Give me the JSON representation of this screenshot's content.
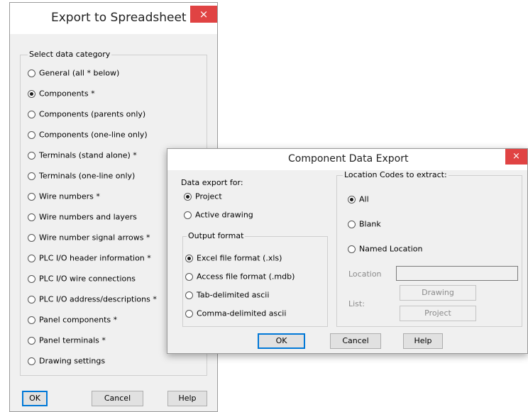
{
  "spreadsheet_dialog": {
    "title": "Export to Spreadsheet",
    "close_glyph": "×",
    "group_label": "Select data category",
    "options": [
      {
        "label": "General (all * below)",
        "selected": false
      },
      {
        "label": "Components *",
        "selected": true
      },
      {
        "label": "Components (parents only)",
        "selected": false
      },
      {
        "label": "Components (one-line only)",
        "selected": false
      },
      {
        "label": "Terminals (stand alone) *",
        "selected": false
      },
      {
        "label": "Terminals (one-line only)",
        "selected": false
      },
      {
        "label": "Wire numbers *",
        "selected": false
      },
      {
        "label": "Wire numbers and layers",
        "selected": false
      },
      {
        "label": "Wire number signal arrows *",
        "selected": false
      },
      {
        "label": "PLC I/O header information *",
        "selected": false
      },
      {
        "label": "PLC I/O wire connections",
        "selected": false
      },
      {
        "label": "PLC I/O address/descriptions *",
        "selected": false
      },
      {
        "label": "Panel components *",
        "selected": false
      },
      {
        "label": "Panel terminals *",
        "selected": false
      },
      {
        "label": "Drawing settings",
        "selected": false
      }
    ],
    "buttons": {
      "ok": "OK",
      "cancel": "Cancel",
      "help": "Help"
    }
  },
  "component_dialog": {
    "title": "Component Data Export",
    "close_glyph": "×",
    "export_for": {
      "label": "Data export for:",
      "options": [
        {
          "label": "Project",
          "selected": true
        },
        {
          "label": "Active drawing",
          "selected": false
        }
      ]
    },
    "output_format": {
      "label": "Output format",
      "options": [
        {
          "label": "Excel file format (.xls)",
          "selected": true
        },
        {
          "label": "Access file format (.mdb)",
          "selected": false
        },
        {
          "label": "Tab-delimited ascii",
          "selected": false
        },
        {
          "label": "Comma-delimited ascii",
          "selected": false
        }
      ]
    },
    "location_codes": {
      "label": "Location Codes to extract:",
      "options": [
        {
          "label": "All",
          "selected": true
        },
        {
          "label": "Blank",
          "selected": false
        },
        {
          "label": "Named Location",
          "selected": false
        }
      ],
      "location_label": "Location",
      "location_value": "",
      "list_label": "List:",
      "drawing_button": "Drawing",
      "project_button": "Project"
    },
    "buttons": {
      "ok": "OK",
      "cancel": "Cancel",
      "help": "Help"
    }
  },
  "colors": {
    "close_button": "#e04343",
    "dialog_bg": "#f0f0f0",
    "focus_border": "#0078d7"
  }
}
